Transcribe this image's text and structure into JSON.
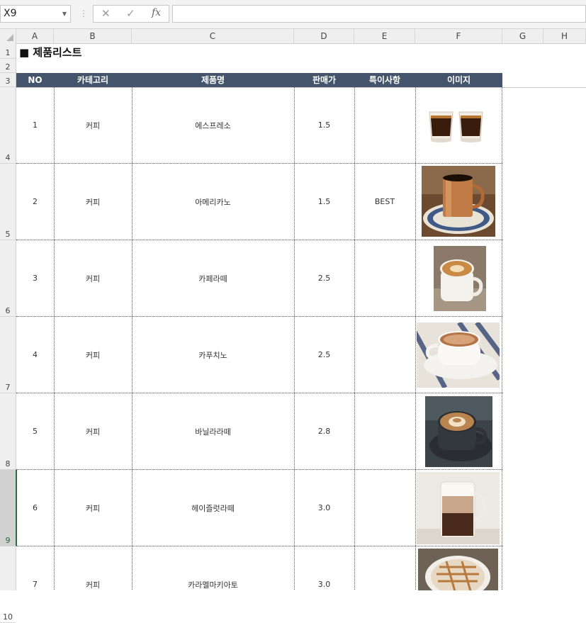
{
  "formula_bar": {
    "name_box": "X9",
    "cancel_icon": "✕",
    "enter_icon": "✓",
    "fx_label": "fx",
    "formula_value": ""
  },
  "columns": [
    "A",
    "B",
    "C",
    "D",
    "E",
    "F",
    "G",
    "H"
  ],
  "rows": [
    "1",
    "2",
    "3",
    "4",
    "5",
    "6",
    "7",
    "8",
    "9",
    "10"
  ],
  "selected_row": "9",
  "sheet": {
    "title": "■ 제품리스트",
    "headers": {
      "no": "NO",
      "category": "카테고리",
      "name": "제품명",
      "price": "판매가",
      "note": "특이사항",
      "image": "이미지"
    },
    "products": [
      {
        "no": "1",
        "category": "커피",
        "name": "에스프레소",
        "price": "1.5",
        "note": "",
        "image": "espresso-shots-photo"
      },
      {
        "no": "2",
        "category": "커피",
        "name": "아메리카노",
        "price": "1.5",
        "note": "BEST",
        "image": "americano-copper-mug-photo"
      },
      {
        "no": "3",
        "category": "커피",
        "name": "카페라떼",
        "price": "2.5",
        "note": "",
        "image": "cafe-latte-photo"
      },
      {
        "no": "4",
        "category": "커피",
        "name": "카푸치노",
        "price": "2.5",
        "note": "",
        "image": "cappuccino-photo"
      },
      {
        "no": "5",
        "category": "커피",
        "name": "바닐라라떼",
        "price": "2.8",
        "note": "",
        "image": "vanilla-latte-photo"
      },
      {
        "no": "6",
        "category": "커피",
        "name": "헤이즐럿라떼",
        "price": "3.0",
        "note": "",
        "image": "hazelnut-latte-photo"
      },
      {
        "no": "7",
        "category": "커피",
        "name": "카라멜마키아토",
        "price": "3.0",
        "note": "",
        "image": "caramel-macchiato-photo"
      }
    ]
  },
  "colors": {
    "header_fill": "#44546a",
    "header_text": "#ffffff",
    "select_green": "#217346"
  }
}
